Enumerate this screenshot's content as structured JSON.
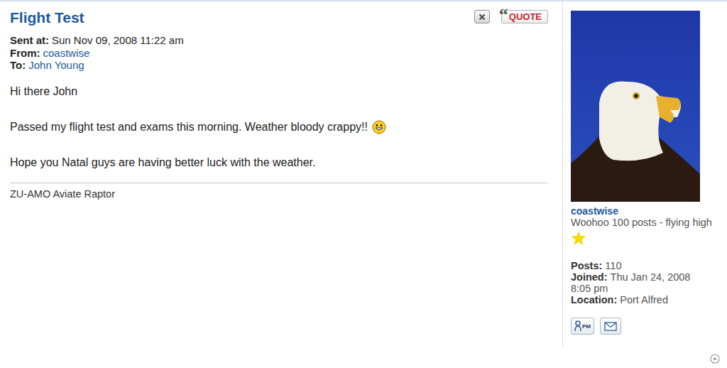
{
  "message": {
    "title": "Flight Test",
    "meta": [
      {
        "label": "Sent at:",
        "value": "Sun Nov 09, 2008 11:22 am",
        "link": false
      },
      {
        "label": "From:",
        "value": "coastwise",
        "link": true
      },
      {
        "label": "To:",
        "value": "John Young",
        "link": true
      }
    ],
    "body": [
      {
        "text": "Hi there John",
        "emoticon": false
      },
      {
        "text": "Passed my flight test and exams this morning. Weather bloody crappy!!",
        "emoticon": true
      },
      {
        "text": "Hope you Natal guys are having better luck with the weather.",
        "emoticon": false
      }
    ],
    "signature": "ZU-AMO Aviate Raptor"
  },
  "quote_button": {
    "mark": "“",
    "label": "QUOTE"
  },
  "author": {
    "name": "coastwise",
    "rank": "Woohoo 100 posts - flying high",
    "stars": 1,
    "stats": [
      {
        "label": "Posts:",
        "value": "110"
      },
      {
        "label": "Joined:",
        "value": "Thu Jan 24, 2008 8:05 pm"
      },
      {
        "label": "Location:",
        "value": "Port Alfred"
      }
    ],
    "pm_button": {
      "label": "PM"
    }
  }
}
